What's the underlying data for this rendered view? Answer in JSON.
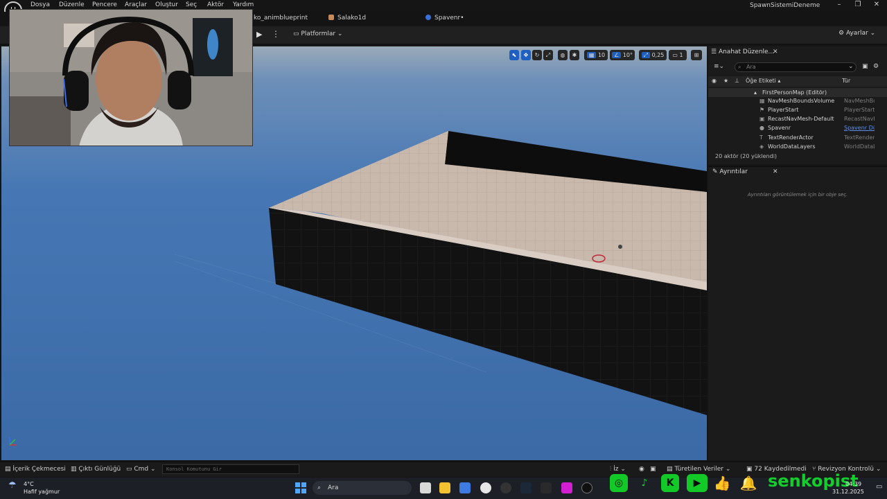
{
  "menu": [
    "Dosya",
    "Düzenle",
    "Pencere",
    "Araçlar",
    "Oluştur",
    "Seç",
    "Aktör",
    "Yardım"
  ],
  "window_title": "SpawnSistemiDeneme",
  "tabs": [
    {
      "label": "ko_animblueprint",
      "icon": "blueprint-icon"
    },
    {
      "label": "Salako1d",
      "icon": "character-icon"
    },
    {
      "label": "Spavenr•",
      "icon": "blueprint-icon"
    }
  ],
  "toolbar": {
    "platforms_label": "Platformlar",
    "settings_label": "Ayarlar"
  },
  "viewport_toolbar": {
    "grid_snap": "10",
    "rotation_snap": "10°",
    "scale_snap": "0,25",
    "camera_speed": "1"
  },
  "outliner": {
    "tab_label": "Anahat Düzenle...",
    "search_placeholder": "Ara",
    "col_label": "Öğe Etiketi ▴",
    "col_type": "Tür",
    "root": "FirstPersonMap (Editör)",
    "rows": [
      {
        "label": "NavMeshBoundsVolume",
        "type": "NavMeshBou"
      },
      {
        "label": "PlayerStart",
        "type": "PlayerStart"
      },
      {
        "label": "RecastNavMesh-Default",
        "type": "RecastNavMe"
      },
      {
        "label": "Spavenr",
        "type": "Spavenr Düz"
      },
      {
        "label": "TextRenderActor",
        "type": "TextRenderAc"
      },
      {
        "label": "WorldDataLayers",
        "type": "WorldDataLay"
      }
    ],
    "count": "20 aktör (20 yüklendi)"
  },
  "details": {
    "tab_label": "Ayrıntılar",
    "empty_text": "Ayrıntıları görüntülemek için bir obje seç."
  },
  "statusbar": {
    "content_drawer": "İçerik Çekmecesi",
    "output_log": "Çıktı Günlüğü",
    "cmd": "Cmd",
    "console_placeholder": "Konsol Komutunu Gir",
    "derived_data": "Türetilen Veriler",
    "saved": "72 Kaydedilmedi",
    "revision": "Revizyon Kontrolü",
    "iz": "İz"
  },
  "taskbar": {
    "weather_temp": "4°C",
    "weather_desc": "Hafif yağmur",
    "search": "Ara",
    "time": "04:39",
    "date": "31.12.2025"
  },
  "overlay": {
    "handle": "senkopist",
    "social_icons": [
      "instagram-icon",
      "tiktok-icon",
      "kick-icon",
      "youtube-icon",
      "like-icon",
      "bell-icon"
    ]
  },
  "colors": {
    "accent": "#1f5fbf",
    "sky": "#3c6ea8",
    "brand_green": "#14cf2b"
  }
}
